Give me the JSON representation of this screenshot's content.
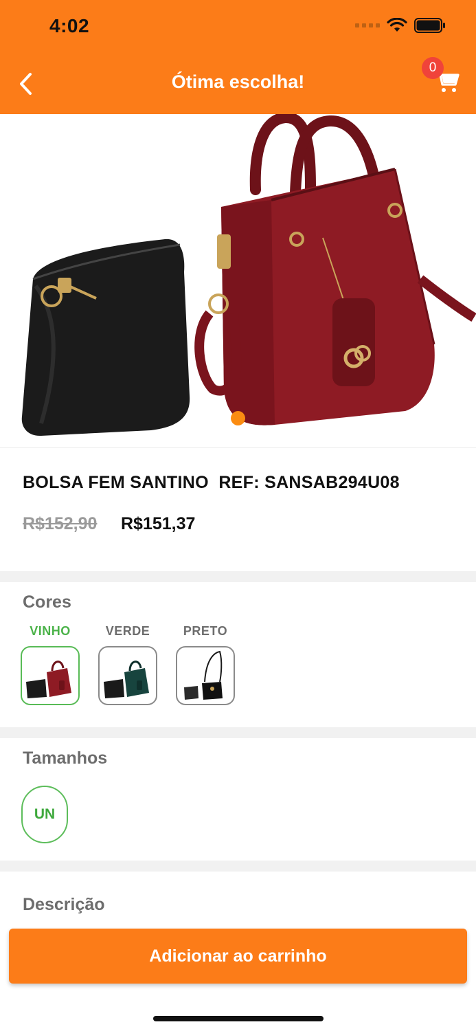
{
  "status_bar": {
    "time": "4:02"
  },
  "header": {
    "title": "Ótima escolha!",
    "cart_count": "0"
  },
  "product": {
    "title": "BOLSA FEM SANTINO  REF: SANSAB294U08",
    "old_price": "R$152,90",
    "price": "R$151,37",
    "image_pages": {
      "current": 1,
      "total": 1
    }
  },
  "colors": {
    "title": "Cores",
    "options": [
      {
        "label": "VINHO",
        "selected": true
      },
      {
        "label": "VERDE",
        "selected": false
      },
      {
        "label": "PRETO",
        "selected": false
      }
    ]
  },
  "sizes": {
    "title": "Tamanhos",
    "options": [
      {
        "label": "UN",
        "selected": true
      }
    ]
  },
  "description": {
    "title": "Descrição"
  },
  "cta": {
    "label": "Adicionar ao carrinho"
  },
  "theme": {
    "accent": "#fc7c18",
    "selected": "#58bb56",
    "badge": "#f0433a"
  }
}
